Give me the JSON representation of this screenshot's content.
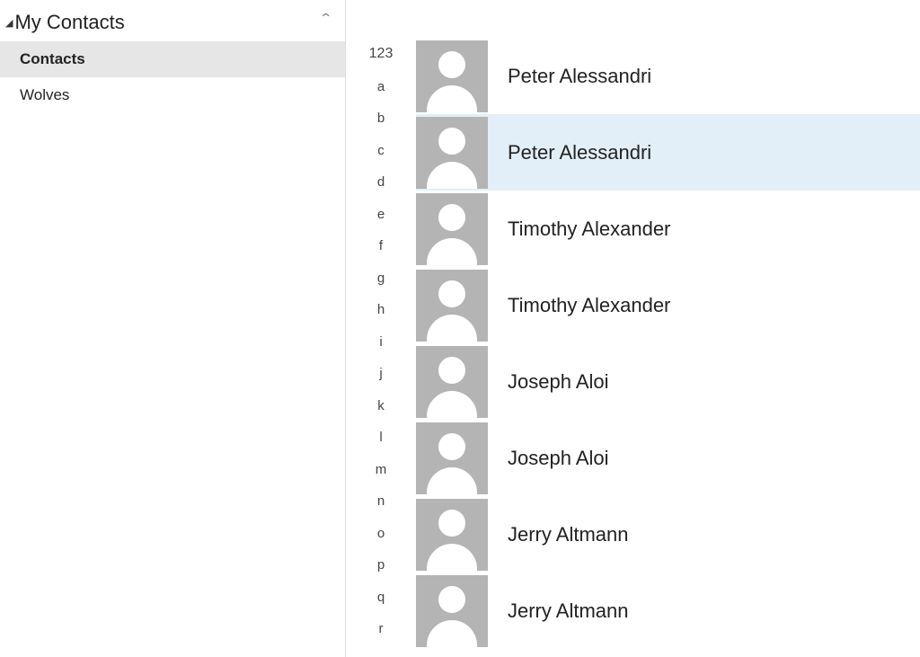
{
  "sidebar": {
    "title": "My Contacts",
    "items": [
      {
        "label": "Contacts",
        "active": true
      },
      {
        "label": "Wolves",
        "active": false
      }
    ]
  },
  "alphaIndex": [
    "123",
    "a",
    "b",
    "c",
    "d",
    "e",
    "f",
    "g",
    "h",
    "i",
    "j",
    "k",
    "l",
    "m",
    "n",
    "o",
    "p",
    "q",
    "r"
  ],
  "contacts": [
    {
      "name": "Peter Alessandri",
      "selected": false
    },
    {
      "name": "Peter Alessandri",
      "selected": true
    },
    {
      "name": "Timothy Alexander",
      "selected": false
    },
    {
      "name": "Timothy Alexander",
      "selected": false
    },
    {
      "name": "Joseph Aloi",
      "selected": false
    },
    {
      "name": "Joseph Aloi",
      "selected": false
    },
    {
      "name": "Jerry Altmann",
      "selected": false
    },
    {
      "name": "Jerry Altmann",
      "selected": false
    }
  ]
}
